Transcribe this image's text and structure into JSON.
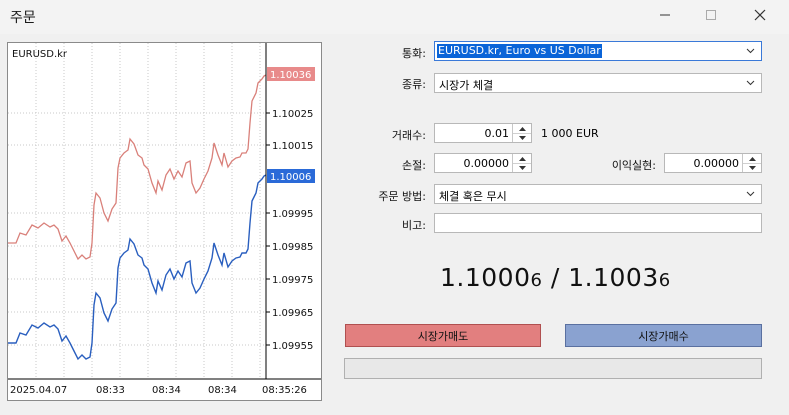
{
  "window": {
    "title": "주문"
  },
  "chart": {
    "symbol_label": "EURUSD.kr",
    "ask_label": "1.10036",
    "bid_label": "1.10006",
    "price_ticks": [
      "1.10025",
      "1.10015",
      "1.09995",
      "1.09985",
      "1.09975",
      "1.09965",
      "1.09955"
    ],
    "time_ticks": [
      "2025.04.07",
      "08:33",
      "08:34",
      "08:34",
      "08:35:26"
    ],
    "colors": {
      "ask": "#d9807a",
      "bid": "#2a5fbf",
      "ask_label_bg": "#e88a8a",
      "bid_label_bg": "#2a6ad8"
    }
  },
  "form": {
    "symbol_label": "통화:",
    "symbol_value": "EURUSD.kr, Euro vs US Dollar",
    "type_label": "종류:",
    "type_value": "시장가 체결",
    "volume_label": "거래수:",
    "volume_value": "0.01",
    "volume_unit": "1 000 EUR",
    "sl_label": "손절:",
    "sl_value": "0.00000",
    "tp_label": "이익실현:",
    "tp_value": "0.00000",
    "fill_label": "주문 방법:",
    "fill_value": "체결 혹은 무시",
    "comment_label": "비고:",
    "comment_value": ""
  },
  "quote": {
    "bid_main": "1.1000",
    "bid_small": "6",
    "sep": " / ",
    "ask_main": "1.1003",
    "ask_small": "6"
  },
  "buttons": {
    "sell_label": "시장가매도",
    "buy_label": "시장가매수"
  }
}
